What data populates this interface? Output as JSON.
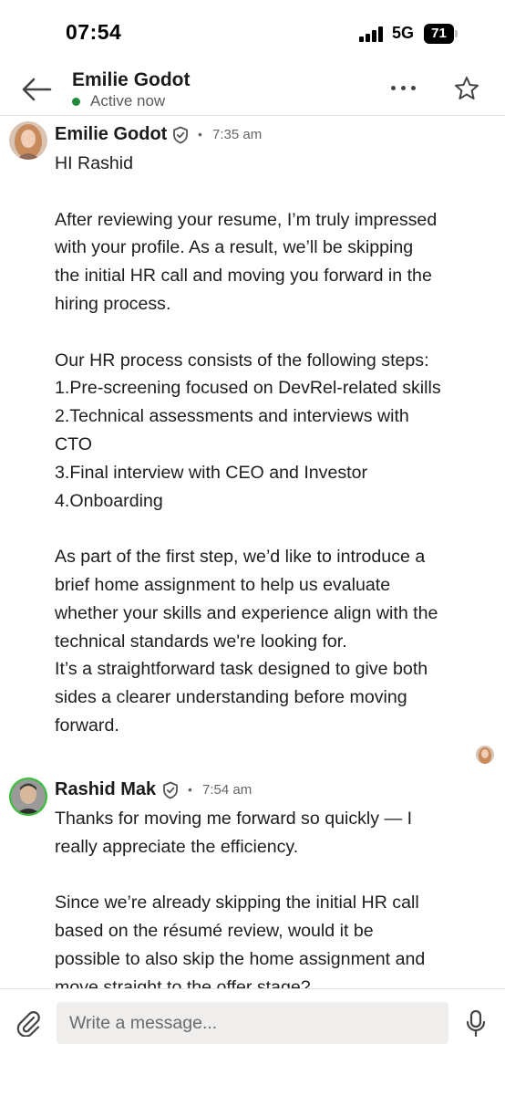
{
  "status_bar": {
    "time": "07:54",
    "network": "5G",
    "battery": "71"
  },
  "header": {
    "contact_name": "Emilie Godot",
    "status": "Active now",
    "status_color": "#1f8a3a"
  },
  "messages": [
    {
      "sender": "Emilie Godot",
      "time": "7:35 am",
      "separator": "•",
      "paragraphs": [
        [
          "HI Rashid"
        ],
        [
          "After reviewing your resume, I’m truly impressed",
          "with your profile. As a result, we’ll be skipping",
          "the initial HR call and moving you forward in the",
          "hiring process."
        ],
        [
          "Our HR process consists of the following steps:",
          "1.Pre-screening focused on DevRel-related skills",
          "2.Technical assessments and interviews with",
          "CTO",
          "3.Final interview with CEO and Investor",
          "4.Onboarding"
        ],
        [
          "As part of the first step, we’d like to introduce a",
          "brief home assignment to help us evaluate",
          "whether your skills and experience align with the",
          "technical standards we're looking for.",
          "It’s a straightforward task designed to give both",
          "sides a clearer understanding before moving",
          "forward."
        ]
      ]
    },
    {
      "sender": "Rashid Mak",
      "time": "7:54 am",
      "separator": "•",
      "paragraphs": [
        [
          "Thanks for moving me forward so quickly — I",
          "really appreciate the efficiency."
        ],
        [
          "Since we’re already skipping the initial HR call",
          "based on the résumé review, would it be",
          "possible to also skip the home assignment and",
          "move straight to the offer stage?"
        ]
      ]
    }
  ],
  "composer": {
    "placeholder": "Write a message..."
  },
  "icons": {
    "back": "arrow-left-icon",
    "more": "more-dots-icon",
    "star": "star-icon",
    "verified": "verified-shield-icon",
    "attach": "paperclip-icon",
    "mic": "microphone-icon"
  },
  "colors": {
    "active": "#1f8a3a",
    "input_bg": "#efeeec",
    "text": "#1d1d1d"
  }
}
